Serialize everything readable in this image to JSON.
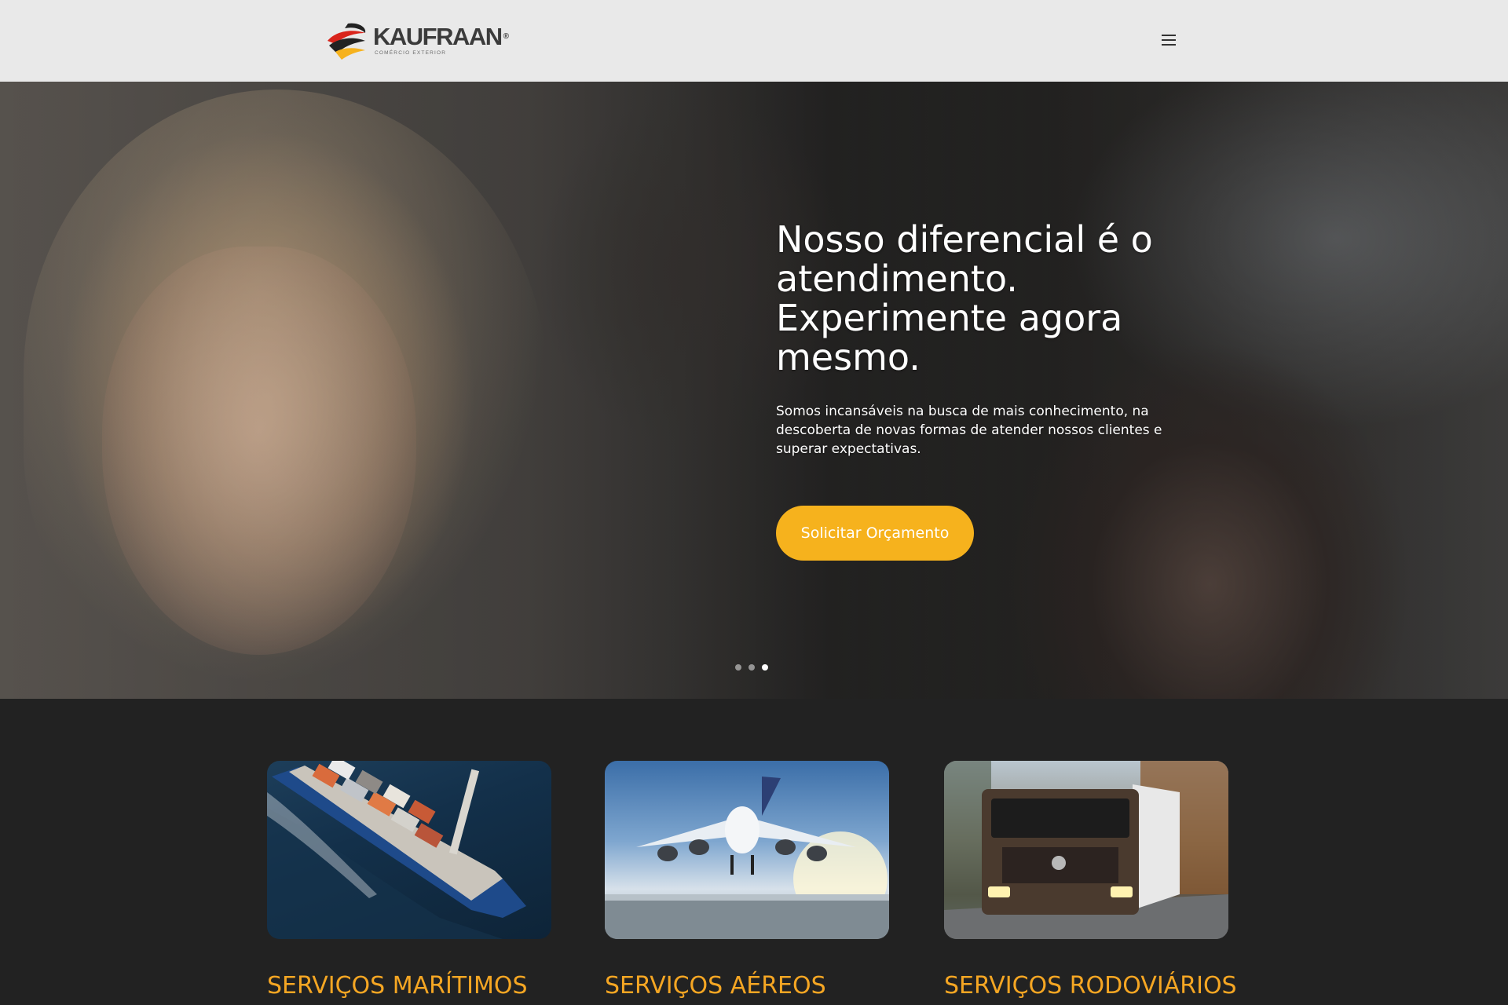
{
  "header": {
    "logo_name": "KAUFRAAN",
    "logo_reg": "®",
    "logo_tagline": "COMÉRCIO EXTERIOR",
    "menu_icon": "hamburger-icon"
  },
  "hero": {
    "title": "Nosso diferencial é o atendimento. Experimente agora mesmo.",
    "description": "Somos incansáveis na busca de mais conhecimento, na descoberta de novas formas de atender nossos clientes e superar expectativas.",
    "cta_label": "Solicitar Orçamento",
    "cta_color": "#f6b21d",
    "slides_total": 3,
    "active_slide": 3
  },
  "services": {
    "accent_color": "#f5a623",
    "items": [
      {
        "title": "SERVIÇOS MARÍTIMOS",
        "image": "cargo-ship-image"
      },
      {
        "title": "SERVIÇOS AÉREOS",
        "image": "airplane-image"
      },
      {
        "title": "SERVIÇOS RODOVIÁRIOS",
        "image": "truck-image"
      }
    ]
  }
}
